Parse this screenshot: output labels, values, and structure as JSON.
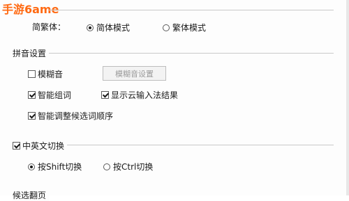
{
  "watermark": "手游6ame",
  "script_mode": {
    "label": "简繁体：",
    "options": [
      {
        "label": "简体模式",
        "selected": true
      },
      {
        "label": "繁体模式",
        "selected": false
      }
    ]
  },
  "pinyin_settings": {
    "title": "拼音设置",
    "fuzzy": {
      "label": "模糊音",
      "checked": false
    },
    "fuzzy_settings_button": "模糊音设置",
    "smart_phrase": {
      "label": "智能组词",
      "checked": true
    },
    "cloud_result": {
      "label": "显示云输入法结果",
      "checked": true
    },
    "smart_order": {
      "label": "智能调整候选词顺序",
      "checked": true
    }
  },
  "cn_en_switch": {
    "title": "中英文切换",
    "checked": true,
    "options": [
      {
        "label": "按Shift切换",
        "selected": true
      },
      {
        "label": "按Ctrl切换",
        "selected": false
      }
    ]
  },
  "candidates_title": "候选翻页"
}
